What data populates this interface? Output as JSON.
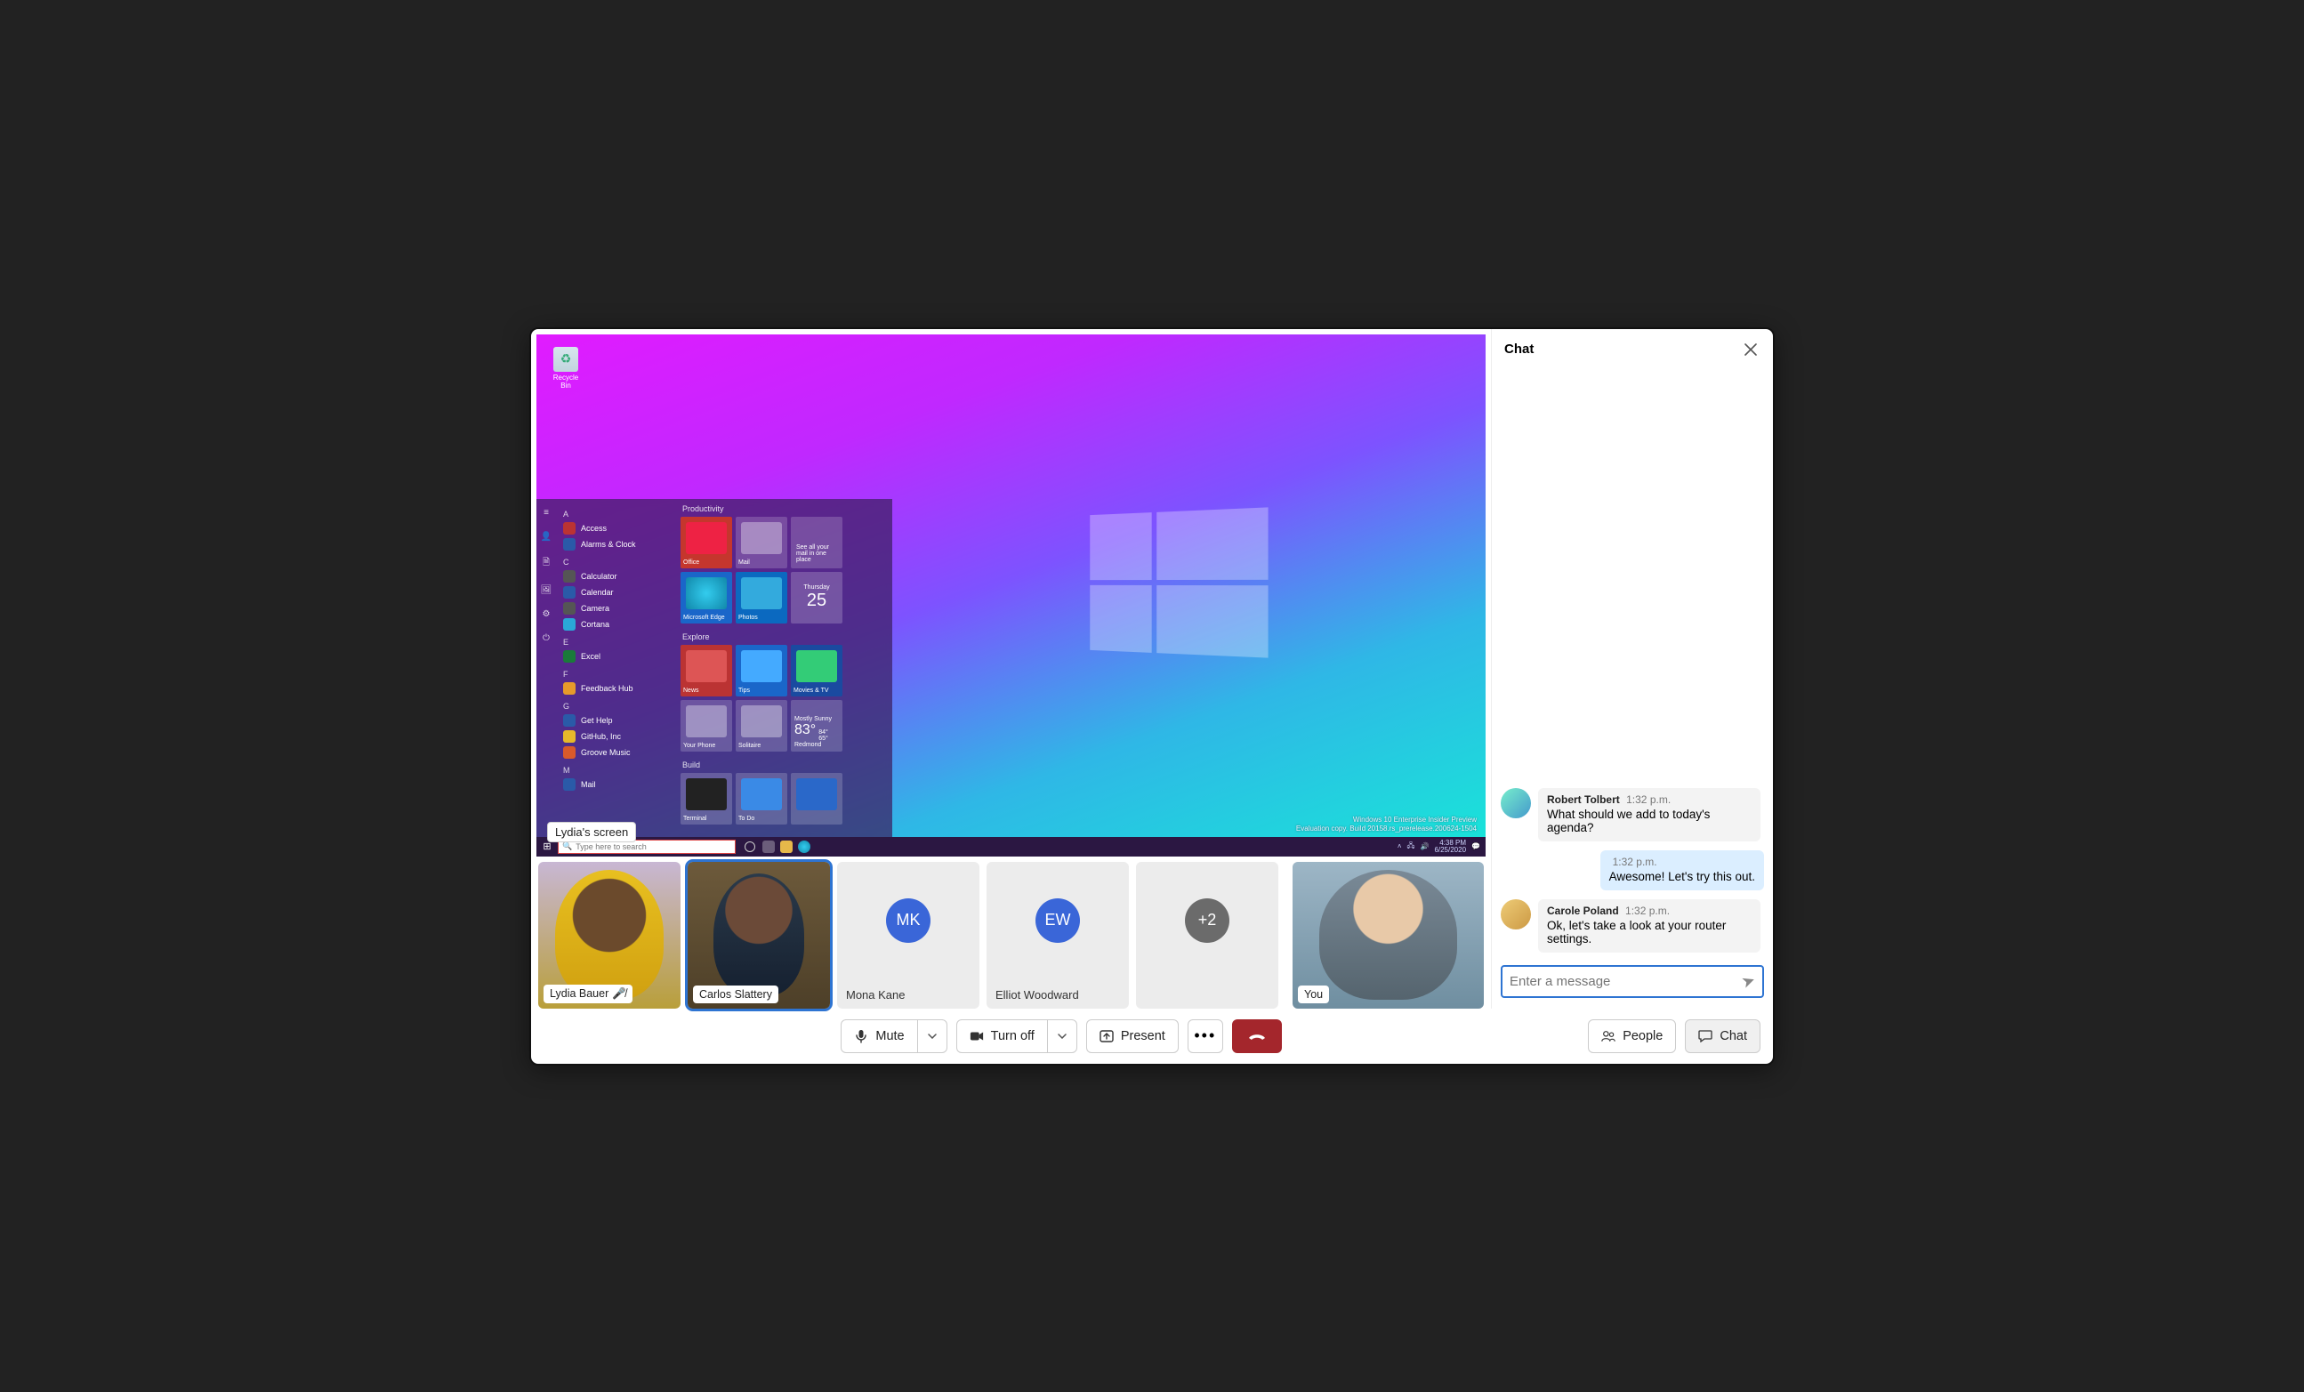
{
  "icons": {
    "recycle_label": "Recycle Bin"
  },
  "screen": {
    "label": "Lydia's screen",
    "start_apps": {
      "a": "A",
      "c": "C",
      "e": "E",
      "f": "F",
      "g": "G",
      "m": "M",
      "access": "Access",
      "alarms": "Alarms & Clock",
      "calculator": "Calculator",
      "calendar": "Calendar",
      "camera": "Camera",
      "cortana": "Cortana",
      "excel": "Excel",
      "feedback": "Feedback Hub",
      "gethelp": "Get Help",
      "github": "GitHub, Inc",
      "groove": "Groove Music",
      "mail": "Mail"
    },
    "start_sections": {
      "productivity": "Productivity",
      "explore": "Explore",
      "build": "Build"
    },
    "tiles": {
      "office": "Office",
      "mail": "Mail",
      "mail_text": "See all your mail in one place",
      "edge": "Microsoft Edge",
      "photos": "Photos",
      "cal_day": "Thursday",
      "cal_num": "25",
      "news": "News",
      "tips": "Tips",
      "movies": "Movies & TV",
      "yourphone": "Your Phone",
      "solitaire": "Solitaire",
      "weather_cond": "Mostly Sunny",
      "weather_temp": "83°",
      "weather_hi": "84°",
      "weather_lo": "65°",
      "weather_city": "Redmond",
      "terminal": "Terminal",
      "todo": "To Do"
    },
    "taskbar": {
      "search_placeholder": "Type here to search",
      "time": "4:38 PM",
      "date": "6/25/2020"
    },
    "watermark": {
      "l1": "Windows 10 Enterprise Insider Preview",
      "l2": "Evaluation copy. Build 20158.rs_prerelease.200624-1504"
    }
  },
  "chat": {
    "title": "Chat",
    "input_placeholder": "Enter a message",
    "messages": [
      {
        "from": "Robert Tolbert",
        "time": "1:32 p.m.",
        "text": "What should we add to today's agenda?",
        "mine": false
      },
      {
        "from": "",
        "time": "1:32 p.m.",
        "text": "Awesome! Let's try this out.",
        "mine": true
      },
      {
        "from": "Carole Poland",
        "time": "1:32 p.m.",
        "text": "Ok, let's take a look at your router settings.",
        "mine": false
      }
    ]
  },
  "roster": {
    "lydia": "Lydia Bauer",
    "carlos": "Carlos Slattery",
    "mona_initials": "MK",
    "mona": "Mona Kane",
    "elliot_initials": "EW",
    "elliot": "Elliot Woodward",
    "extra": "+2",
    "you": "You"
  },
  "controls": {
    "mute": "Mute",
    "turnoff": "Turn off",
    "present": "Present",
    "people": "People",
    "chat": "Chat"
  }
}
